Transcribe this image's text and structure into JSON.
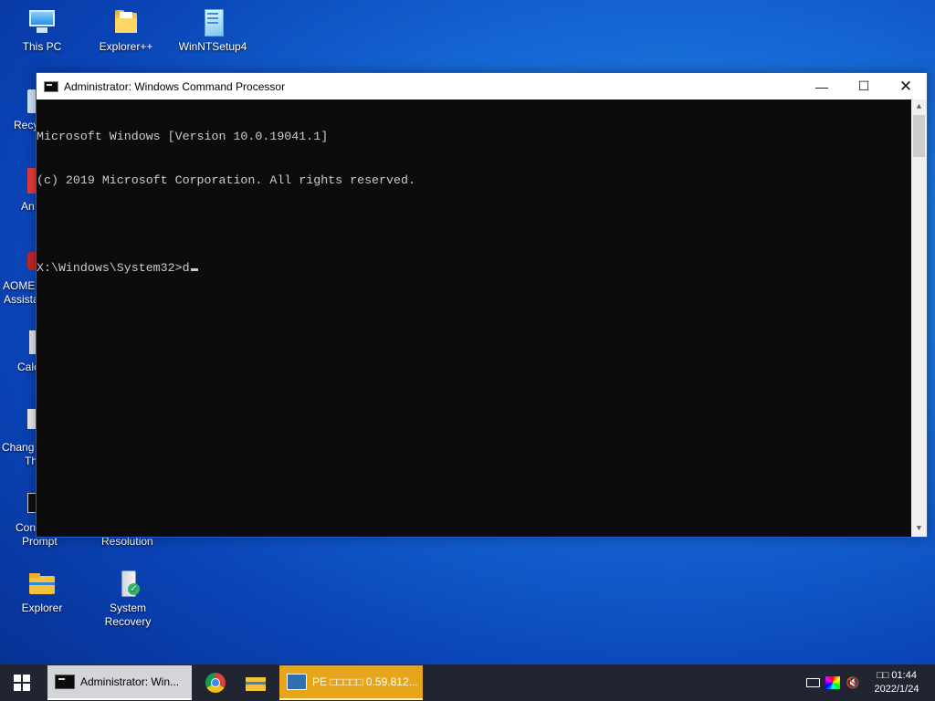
{
  "desktop": {
    "icons": [
      {
        "label": "This PC"
      },
      {
        "label": "Explorer++"
      },
      {
        "label": "WinNTSetup4"
      },
      {
        "label": "Explorer"
      },
      {
        "label": "System Recovery"
      }
    ],
    "partial_labels": {
      "recycle": "Recy",
      "app2": "An",
      "aomei_1": "AOME",
      "aomei_2": "Assista",
      "calc": "Calc",
      "change_1": "Chang",
      "change_2": "Th",
      "cmd_1": "Con",
      "cmd_2": "Prompt",
      "resolution": "Resolution"
    }
  },
  "window": {
    "title": "Administrator: Windows Command Processor",
    "controls": {
      "minimize": "—",
      "maximize": "☐",
      "close": "✕"
    },
    "console_lines": [
      "Microsoft Windows [Version 10.0.19041.1]",
      "(c) 2019 Microsoft Corporation. All rights reserved.",
      "",
      "X:\\Windows\\System32>d"
    ]
  },
  "taskbar": {
    "cmd_label": "Administrator: Win...",
    "pe_label": "PE □□□□□ 0.59.812...",
    "clock_time": "□□ 01:44",
    "clock_date": "2022/1/24"
  },
  "icons": {
    "start": "windows-logo",
    "cmd": "command-prompt",
    "chrome": "chrome",
    "explorer": "folder",
    "keyboard": "keyboard",
    "color": "color-wheel",
    "volume": "speaker-muted"
  }
}
